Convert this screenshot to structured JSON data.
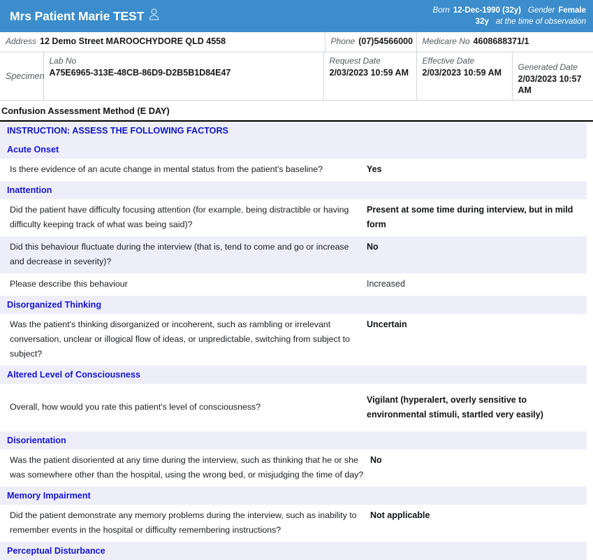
{
  "patient": {
    "name": "Mrs Patient Marie TEST",
    "avatar_icon": "person-icon",
    "born_label": "Born",
    "born_value": "12-Dec-1990 (32y)",
    "gender_label": "Gender",
    "gender_value": "Female",
    "age_at_observation_value": "32y",
    "age_at_observation_label": "at the time of observation"
  },
  "demographics": {
    "address_label": "Address",
    "address_value": "12 Demo Street MAROOCHYDORE QLD 4558",
    "phone_label": "Phone",
    "phone_value": "(07)54566000",
    "medicare_label": "Medicare No",
    "medicare_value": "4608688371/1",
    "specimen_label": "Specimen",
    "lab_no_label": "Lab No",
    "lab_no_value": "A75E6965-313E-48CB-86D9-D2B5B1D84E47",
    "request_date_label": "Request Date",
    "request_date_value": "2/03/2023 10:59 AM",
    "effective_date_label": "Effective Date",
    "effective_date_value": "2/03/2023 10:59 AM",
    "generated_date_label": "Generated Date",
    "generated_date_value": "2/03/2023 10:57 AM"
  },
  "report": {
    "title": "Confusion Assessment Method (E DAY)",
    "instruction": "INSTRUCTION: ASSESS THE FOLLOWING FACTORS"
  },
  "sections": [
    {
      "heading": "Acute Onset",
      "rows": [
        {
          "question": "Is there evidence of an acute change in mental status from the patient's baseline?",
          "answer": "Yes"
        }
      ]
    },
    {
      "heading": "Inattention",
      "rows": [
        {
          "question": "Did the patient have difficulty focusing attention (for example, being distractible or having difficulty keeping track of what was being said)?",
          "answer": "Present at some time during interview, but in mild form"
        },
        {
          "question": "Did this behaviour fluctuate during the interview (that is, tend to come and go or increase and decrease in severity)?",
          "answer": "No"
        },
        {
          "question": "Please describe this behaviour",
          "answer": "Increased"
        }
      ]
    },
    {
      "heading": "Disorganized Thinking",
      "rows": [
        {
          "question": "Was the patient's thinking disorganized or incoherent, such as rambling or irrelevant conversation, unclear or illogical flow of ideas, or unpredictable, switching from subject to subject?",
          "answer": "Uncertain"
        }
      ]
    },
    {
      "heading": "Altered Level of Consciousness",
      "rows": [
        {
          "question": "Overall, how would you rate this patient's level of consciousness?",
          "answer": "Vigilant (hyperalert, overly sensitive to environmental stimuli, startled very easily)"
        }
      ]
    },
    {
      "heading": "Disorientation",
      "rows": [
        {
          "question": "Was the patient disoriented at any time during the interview, such as thinking that he or she was somewhere other than the hospital, using the wrong bed, or misjudging the time of day?",
          "answer": "No"
        }
      ]
    },
    {
      "heading": "Memory Impairment",
      "rows": [
        {
          "question": "Did the patient demonstrate any memory problems during the interview, such as inability to remember events in the hospital or difficulty remembering instructions?",
          "answer": "Not applicable"
        }
      ]
    },
    {
      "heading": "Perceptual Disturbance",
      "rows": []
    }
  ],
  "colors": {
    "banner_blue": "#3c8dcb",
    "section_heading_blue": "#1614d4",
    "band_lavender": "#eeeefa",
    "label_grey": "#555a5f"
  }
}
